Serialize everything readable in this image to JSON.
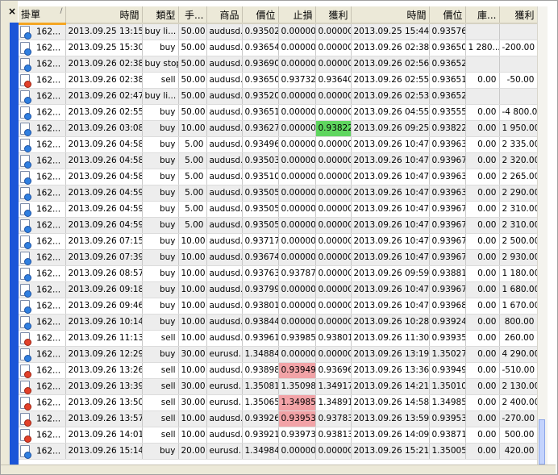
{
  "window": {
    "close_glyph": "×"
  },
  "columns": [
    {
      "key": "ticket",
      "label": "掛單",
      "sort_glyph": "/"
    },
    {
      "key": "open_time",
      "label": "時間"
    },
    {
      "key": "type",
      "label": "類型"
    },
    {
      "key": "size",
      "label": "手..."
    },
    {
      "key": "symbol",
      "label": "商品"
    },
    {
      "key": "open_price",
      "label": "價位"
    },
    {
      "key": "sl",
      "label": "止損"
    },
    {
      "key": "tp",
      "label": "獲利"
    },
    {
      "key": "close_time",
      "label": "時間"
    },
    {
      "key": "close_price",
      "label": "價位"
    },
    {
      "key": "swap",
      "label": "庫..."
    },
    {
      "key": "profit",
      "label": "獲利"
    }
  ],
  "rows": [
    {
      "dir": "buy",
      "ticket": "162...",
      "open_time": "2013.09.25 13:15",
      "type": "buy li...",
      "size": "50.00",
      "symbol": "audusd.",
      "open_price": "0.93502",
      "sl": "0.00000",
      "tp": "0.00000",
      "close_time": "2013.09.25 15:44",
      "close_price": "0.93576",
      "swap": "",
      "profit": "",
      "hl": ""
    },
    {
      "dir": "buy",
      "ticket": "162...",
      "open_time": "2013.09.25 15:30",
      "type": "buy",
      "size": "50.00",
      "symbol": "audusd.",
      "open_price": "0.93654",
      "sl": "0.00000",
      "tp": "0.00000",
      "close_time": "2013.09.26 02:38",
      "close_price": "0.93650",
      "swap": "1 280....",
      "profit": "-200.00",
      "hl": ""
    },
    {
      "dir": "buy",
      "ticket": "162...",
      "open_time": "2013.09.26 02:38",
      "type": "buy stop",
      "size": "50.00",
      "symbol": "audusd.",
      "open_price": "0.93690",
      "sl": "0.00000",
      "tp": "0.00000",
      "close_time": "2013.09.26 02:56",
      "close_price": "0.93652",
      "swap": "",
      "profit": "",
      "hl": ""
    },
    {
      "dir": "sell",
      "ticket": "162...",
      "open_time": "2013.09.26 02:38",
      "type": "sell",
      "size": "50.00",
      "symbol": "audusd.",
      "open_price": "0.93650",
      "sl": "0.93732",
      "tp": "0.93640",
      "close_time": "2013.09.26 02:55",
      "close_price": "0.93651",
      "swap": "0.00",
      "profit": "-50.00",
      "hl": ""
    },
    {
      "dir": "buy",
      "ticket": "162...",
      "open_time": "2013.09.26 02:47",
      "type": "buy li...",
      "size": "50.00",
      "symbol": "audusd.",
      "open_price": "0.93520",
      "sl": "0.00000",
      "tp": "0.00000",
      "close_time": "2013.09.26 02:53",
      "close_price": "0.93652",
      "swap": "",
      "profit": "",
      "hl": ""
    },
    {
      "dir": "buy",
      "ticket": "162...",
      "open_time": "2013.09.26 02:55",
      "type": "buy",
      "size": "50.00",
      "symbol": "audusd.",
      "open_price": "0.93651",
      "sl": "0.00000",
      "tp": "0.00000",
      "close_time": "2013.09.26 04:55",
      "close_price": "0.93555",
      "swap": "0.00",
      "profit": "-4 800.00",
      "hl": ""
    },
    {
      "dir": "buy",
      "ticket": "162...",
      "open_time": "2013.09.26 03:08",
      "type": "buy",
      "size": "10.00",
      "symbol": "audusd.",
      "open_price": "0.93627",
      "sl": "0.00000",
      "tp": "0.93822",
      "close_time": "2013.09.26 09:25",
      "close_price": "0.93822",
      "swap": "0.00",
      "profit": "1 950.00",
      "hl": "tp-green"
    },
    {
      "dir": "buy",
      "ticket": "162...",
      "open_time": "2013.09.26 04:58",
      "type": "buy",
      "size": "5.00",
      "symbol": "audusd.",
      "open_price": "0.93496",
      "sl": "0.00000",
      "tp": "0.00000",
      "close_time": "2013.09.26 10:47",
      "close_price": "0.93963",
      "swap": "0.00",
      "profit": "2 335.00",
      "hl": ""
    },
    {
      "dir": "buy",
      "ticket": "162...",
      "open_time": "2013.09.26 04:58",
      "type": "buy",
      "size": "5.00",
      "symbol": "audusd.",
      "open_price": "0.93503",
      "sl": "0.00000",
      "tp": "0.00000",
      "close_time": "2013.09.26 10:47",
      "close_price": "0.93967",
      "swap": "0.00",
      "profit": "2 320.00",
      "hl": ""
    },
    {
      "dir": "buy",
      "ticket": "162...",
      "open_time": "2013.09.26 04:58",
      "type": "buy",
      "size": "5.00",
      "symbol": "audusd.",
      "open_price": "0.93510",
      "sl": "0.00000",
      "tp": "0.00000",
      "close_time": "2013.09.26 10:47",
      "close_price": "0.93963",
      "swap": "0.00",
      "profit": "2 265.00",
      "hl": ""
    },
    {
      "dir": "buy",
      "ticket": "162...",
      "open_time": "2013.09.26 04:59",
      "type": "buy",
      "size": "5.00",
      "symbol": "audusd.",
      "open_price": "0.93505",
      "sl": "0.00000",
      "tp": "0.00000",
      "close_time": "2013.09.26 10:47",
      "close_price": "0.93963",
      "swap": "0.00",
      "profit": "2 290.00",
      "hl": ""
    },
    {
      "dir": "buy",
      "ticket": "162...",
      "open_time": "2013.09.26 04:59",
      "type": "buy",
      "size": "5.00",
      "symbol": "audusd.",
      "open_price": "0.93505",
      "sl": "0.00000",
      "tp": "0.00000",
      "close_time": "2013.09.26 10:47",
      "close_price": "0.93967",
      "swap": "0.00",
      "profit": "2 310.00",
      "hl": ""
    },
    {
      "dir": "buy",
      "ticket": "162...",
      "open_time": "2013.09.26 04:59",
      "type": "buy",
      "size": "5.00",
      "symbol": "audusd.",
      "open_price": "0.93505",
      "sl": "0.00000",
      "tp": "0.00000",
      "close_time": "2013.09.26 10:47",
      "close_price": "0.93967",
      "swap": "0.00",
      "profit": "2 310.00",
      "hl": ""
    },
    {
      "dir": "buy",
      "ticket": "162...",
      "open_time": "2013.09.26 07:15",
      "type": "buy",
      "size": "10.00",
      "symbol": "audusd.",
      "open_price": "0.93717",
      "sl": "0.00000",
      "tp": "0.00000",
      "close_time": "2013.09.26 10:47",
      "close_price": "0.93967",
      "swap": "0.00",
      "profit": "2 500.00",
      "hl": ""
    },
    {
      "dir": "buy",
      "ticket": "162...",
      "open_time": "2013.09.26 07:39",
      "type": "buy",
      "size": "10.00",
      "symbol": "audusd.",
      "open_price": "0.93674",
      "sl": "0.00000",
      "tp": "0.00000",
      "close_time": "2013.09.26 10:47",
      "close_price": "0.93967",
      "swap": "0.00",
      "profit": "2 930.00",
      "hl": ""
    },
    {
      "dir": "buy",
      "ticket": "162...",
      "open_time": "2013.09.26 08:57",
      "type": "buy",
      "size": "10.00",
      "symbol": "audusd.",
      "open_price": "0.93763",
      "sl": "0.93787",
      "tp": "0.00000",
      "close_time": "2013.09.26 09:59",
      "close_price": "0.93881",
      "swap": "0.00",
      "profit": "1 180.00",
      "hl": ""
    },
    {
      "dir": "buy",
      "ticket": "162...",
      "open_time": "2013.09.26 09:18",
      "type": "buy",
      "size": "10.00",
      "symbol": "audusd.",
      "open_price": "0.93799",
      "sl": "0.00000",
      "tp": "0.00000",
      "close_time": "2013.09.26 10:47",
      "close_price": "0.93967",
      "swap": "0.00",
      "profit": "1 680.00",
      "hl": ""
    },
    {
      "dir": "buy",
      "ticket": "162...",
      "open_time": "2013.09.26 09:46",
      "type": "buy",
      "size": "10.00",
      "symbol": "audusd.",
      "open_price": "0.93801",
      "sl": "0.00000",
      "tp": "0.00000",
      "close_time": "2013.09.26 10:47",
      "close_price": "0.93968",
      "swap": "0.00",
      "profit": "1 670.00",
      "hl": ""
    },
    {
      "dir": "buy",
      "ticket": "162...",
      "open_time": "2013.09.26 10:14",
      "type": "buy",
      "size": "10.00",
      "symbol": "audusd.",
      "open_price": "0.93844",
      "sl": "0.00000",
      "tp": "0.00000",
      "close_time": "2013.09.26 10:28",
      "close_price": "0.93924",
      "swap": "0.00",
      "profit": "800.00",
      "hl": ""
    },
    {
      "dir": "sell",
      "ticket": "162...",
      "open_time": "2013.09.26 11:13",
      "type": "sell",
      "size": "10.00",
      "symbol": "audusd.",
      "open_price": "0.93961",
      "sl": "0.93985",
      "tp": "0.93801",
      "close_time": "2013.09.26 11:30",
      "close_price": "0.93935",
      "swap": "0.00",
      "profit": "260.00",
      "hl": ""
    },
    {
      "dir": "buy",
      "ticket": "162...",
      "open_time": "2013.09.26 12:29",
      "type": "buy",
      "size": "30.00",
      "symbol": "eurusd.",
      "open_price": "1.34884",
      "sl": "0.00000",
      "tp": "0.00000",
      "close_time": "2013.09.26 13:19",
      "close_price": "1.35027",
      "swap": "0.00",
      "profit": "4 290.00",
      "hl": ""
    },
    {
      "dir": "sell",
      "ticket": "162...",
      "open_time": "2013.09.26 13:26",
      "type": "sell",
      "size": "10.00",
      "symbol": "audusd.",
      "open_price": "0.93898",
      "sl": "0.93949",
      "tp": "0.93696",
      "close_time": "2013.09.26 13:36",
      "close_price": "0.93949",
      "swap": "0.00",
      "profit": "-510.00",
      "hl": "sl-red"
    },
    {
      "dir": "sell",
      "ticket": "162...",
      "open_time": "2013.09.26 13:39",
      "type": "sell",
      "size": "30.00",
      "symbol": "eurusd.",
      "open_price": "1.35081",
      "sl": "1.35098",
      "tp": "1.34917",
      "close_time": "2013.09.26 14:21",
      "close_price": "1.35010",
      "swap": "0.00",
      "profit": "2 130.00",
      "hl": ""
    },
    {
      "dir": "sell",
      "ticket": "162...",
      "open_time": "2013.09.26 13:50",
      "type": "sell",
      "size": "30.00",
      "symbol": "eurusd.",
      "open_price": "1.35065",
      "sl": "1.34985",
      "tp": "1.34891",
      "close_time": "2013.09.26 14:58",
      "close_price": "1.34985",
      "swap": "0.00",
      "profit": "2 400.00",
      "hl": "sl-red"
    },
    {
      "dir": "sell",
      "ticket": "162...",
      "open_time": "2013.09.26 13:57",
      "type": "sell",
      "size": "10.00",
      "symbol": "audusd.",
      "open_price": "0.93926",
      "sl": "0.93953",
      "tp": "0.93783",
      "close_time": "2013.09.26 13:59",
      "close_price": "0.93953",
      "swap": "0.00",
      "profit": "-270.00",
      "hl": "sl-red"
    },
    {
      "dir": "sell",
      "ticket": "162...",
      "open_time": "2013.09.26 14:01",
      "type": "sell",
      "size": "10.00",
      "symbol": "audusd.",
      "open_price": "0.93921",
      "sl": "0.93973",
      "tp": "0.93813",
      "close_time": "2013.09.26 14:09",
      "close_price": "0.93871",
      "swap": "0.00",
      "profit": "500.00",
      "hl": ""
    },
    {
      "dir": "buy",
      "ticket": "162...",
      "open_time": "2013.09.26 15:14",
      "type": "buy",
      "size": "20.00",
      "symbol": "eurusd.",
      "open_price": "1.34984",
      "sl": "0.00000",
      "tp": "0.00000",
      "close_time": "2013.09.26 15:21",
      "close_price": "1.35005",
      "swap": "0.00",
      "profit": "420.00",
      "hl": ""
    }
  ],
  "colors": {
    "header_bg": "#ece9d8",
    "row_alt": "#ededed",
    "sl_highlight": "#f2a3a7",
    "tp_highlight": "#5fd65f",
    "side_bar": "#1b55d8",
    "sort_underline": "#f5a623"
  },
  "icons": {
    "buy": "ticket-buy-icon",
    "sell": "ticket-sell-icon"
  }
}
